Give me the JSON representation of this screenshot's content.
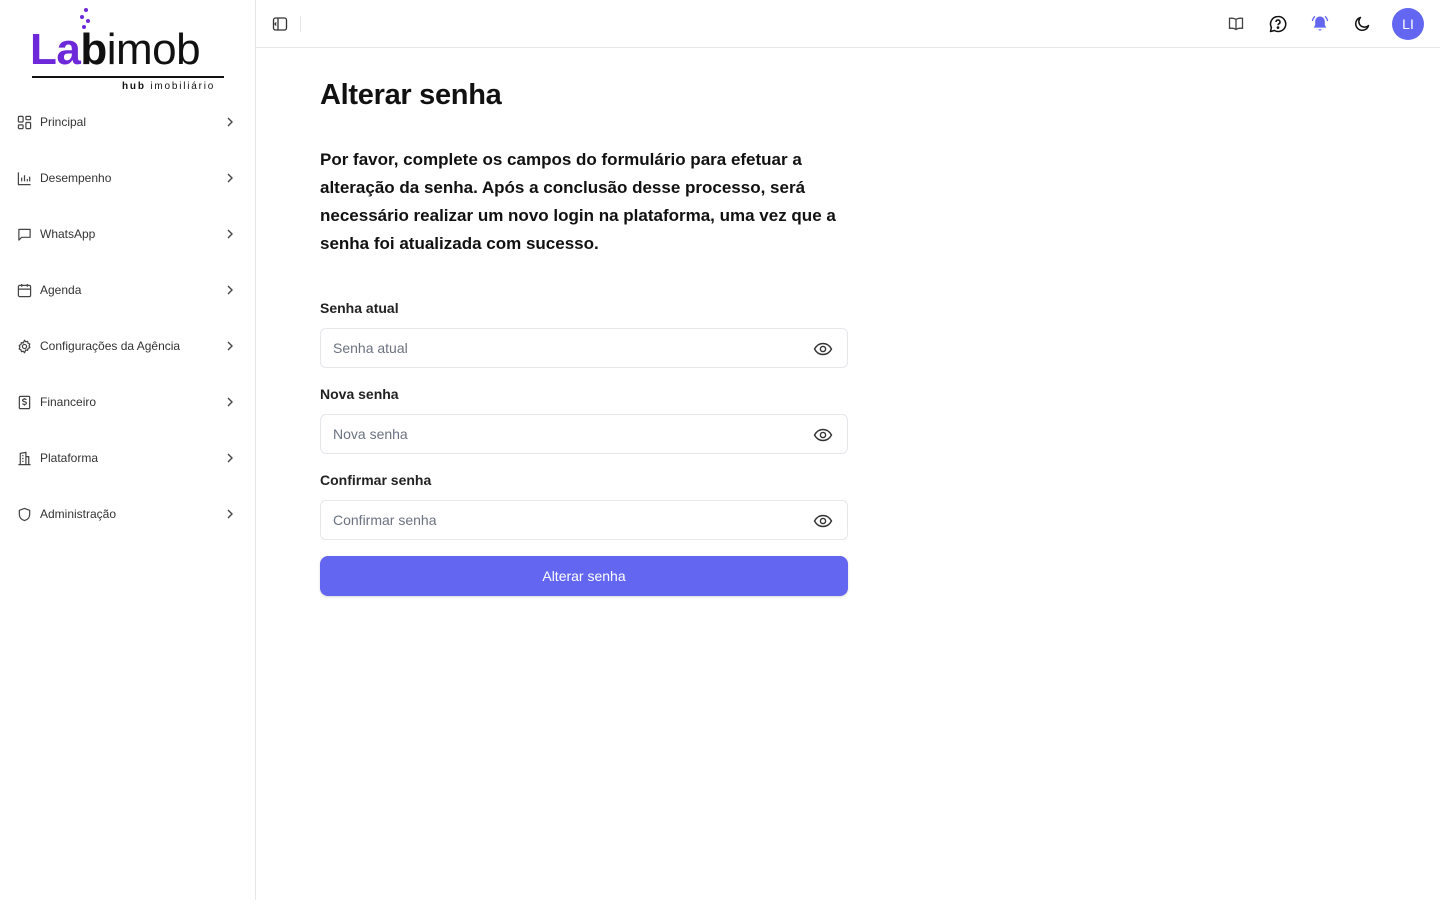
{
  "logo": {
    "word_la": "La",
    "word_b": "b",
    "word_imob": "imob",
    "sub_bold": "hub",
    "sub_rest": "imobiliário"
  },
  "sidebar": {
    "items": [
      {
        "label": "Principal",
        "icon": "grid-icon"
      },
      {
        "label": "Desempenho",
        "icon": "bar-chart-icon"
      },
      {
        "label": "WhatsApp",
        "icon": "message-icon"
      },
      {
        "label": "Agenda",
        "icon": "calendar-icon"
      },
      {
        "label": "Configurações da Agência",
        "icon": "gear-icon"
      },
      {
        "label": "Financeiro",
        "icon": "dollar-icon"
      },
      {
        "label": "Plataforma",
        "icon": "building-icon"
      },
      {
        "label": "Administração",
        "icon": "shield-icon"
      }
    ]
  },
  "topbar": {
    "icons": [
      "book-icon",
      "help-chat-icon",
      "bell-icon",
      "moon-icon"
    ],
    "avatar_initials": "LI"
  },
  "colors": {
    "accent": "#6366f1",
    "brand": "#6d28d9"
  },
  "form": {
    "title": "Alterar senha",
    "description": "Por favor, complete os campos do formulário para efetuar a alteração da senha. Após a conclusão desse processo, será necessário realizar um novo login na plataforma, uma vez que a senha foi atualizada com sucesso.",
    "current": {
      "label": "Senha atual",
      "placeholder": "Senha atual",
      "value": ""
    },
    "new": {
      "label": "Nova senha",
      "placeholder": "Nova senha",
      "value": ""
    },
    "confirm": {
      "label": "Confirmar senha",
      "placeholder": "Confirmar senha",
      "value": ""
    },
    "submit_label": "Alterar senha"
  }
}
